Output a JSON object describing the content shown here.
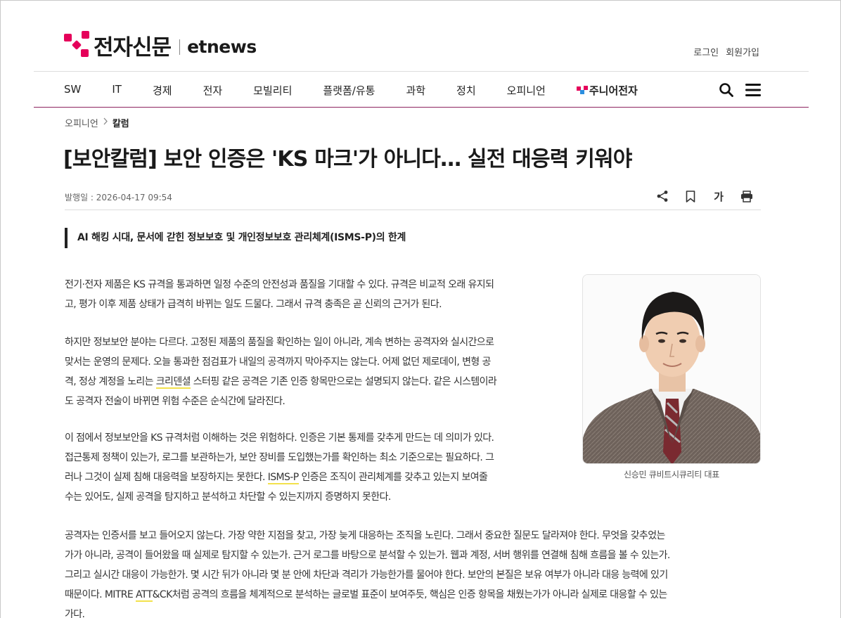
{
  "header": {
    "logo_ko": "전자신문",
    "logo_en": "etnews",
    "login": "로그인",
    "signup": "회원가입"
  },
  "nav": {
    "items": [
      "SW",
      "IT",
      "경제",
      "전자",
      "모빌리티",
      "플랫폼/유통",
      "과학",
      "정치",
      "오피니언"
    ],
    "junior": "주니어전자",
    "search_icon": "search-icon",
    "menu_icon": "hamburger-menu-icon"
  },
  "breadcrumb": {
    "parent": "오피니언",
    "current": "칼럼"
  },
  "article": {
    "title": "[보안칼럼] 보안 인증은 'KS 마크'가 아니다… 실전 대응력 키워야",
    "date": "발행일 : 2026-04-17 09:54",
    "font_tool": "가",
    "subtitle": "AI 해킹 시대, 문서에 갇힌 정보보호 및 개인정보보호 관리체계(ISMS-P)의 한계",
    "photo_caption": "신승민 큐비트시큐리티 대표",
    "p1": [
      "전기·전자 제품은 KS 규격을 통과하면 일정 수준의 안전성과 품질을 기대할 수 있다. 규격은 비교적 오래 유지되",
      "고, 평가 이후 제품 상태가 급격히 바뀌는 일도 드물다. 그래서 규격 충족은 곧 신뢰의 근거가 된다."
    ],
    "p2": {
      "l1": "하지만 정보보안 분야는 다르다. 고정된 제품의 품질을 확인하는 일이 아니라, 계속 변하는 공격자와 실시간으로",
      "l2": "맞서는 운영의 문제다. 오늘 통과한 점검표가 내일의 공격까지 막아주지는 않는다. 어제 없던 제로데이, 변형 공",
      "l3a": "격, 정상 계정을 노리는 ",
      "l3hl": "크리덴셜",
      "l3b": " 스터핑 같은 공격은 기존 인증 항목만으로는 설명되지 않는다. 같은 시스템이라",
      "l4": "도 공격자 전술이 바뀌면 위험 수준은 순식간에 달라진다."
    },
    "p3": {
      "l1": "이 점에서 정보보안을 KS 규격처럼 이해하는 것은 위험하다. 인증은 기본 통제를 갖추게 만드는 데 의미가 있다.",
      "l2": "접근통제 정책이 있는가, 로그를 보관하는가, 보안 장비를 도입했는가를 확인하는 최소 기준으로는 필요하다. 그",
      "l3": "러나 그것이 실제 침해 대응력을 보장하지는 못한다.",
      "l3hl": "ISMS-P",
      "l3b": " 인증은 조직이 관리체계를 갖추고 있는지 보여줄",
      "l4": "수는 있어도, 실제 공격을 탐지하고 분석하고 차단할 수 있는지까지 증명하지 못한다."
    },
    "p4": {
      "l1": "공격자는 인증서를 보고 들어오지 않는다. 가장 약한 지점을 찾고, 가장 늦게 대응하는 조직을 노린다. 그래서 중요한 질문도 달라져야 한다. 무엇을 갖추었는",
      "l2": "가가 아니라, 공격이 들어왔을 때 실제로 탐지할 수 있는가. 근거 로그를 바탕으로 분석할 수 있는가. 웹과 계정, 서버 행위를 연결해 침해 흐름을 볼 수 있는가.",
      "l3": "그리고 실시간 대응이 가능한가. 몇 시간 뒤가 아니라 몇 분 안에 차단과 격리가 가능한가를 물어야 한다. 보안의 본질은 보유 여부가 아니라 대응 능력에 있기",
      "l4a": "때문이다. MITRE ",
      "l4hl": "ATT",
      "l4b": "&CK처럼 공격의 흐름을 체계적으로 분석하는 글로벌 표준이 보여주듯, 핵심은 인증 항목을 채웠는가가 아니라 실제로 대응할 수 있는",
      "l5": "가다."
    }
  },
  "colors": {
    "brand": "#e5005a",
    "nav_rule": "#8e2460",
    "highlight": "#f2e14c"
  }
}
